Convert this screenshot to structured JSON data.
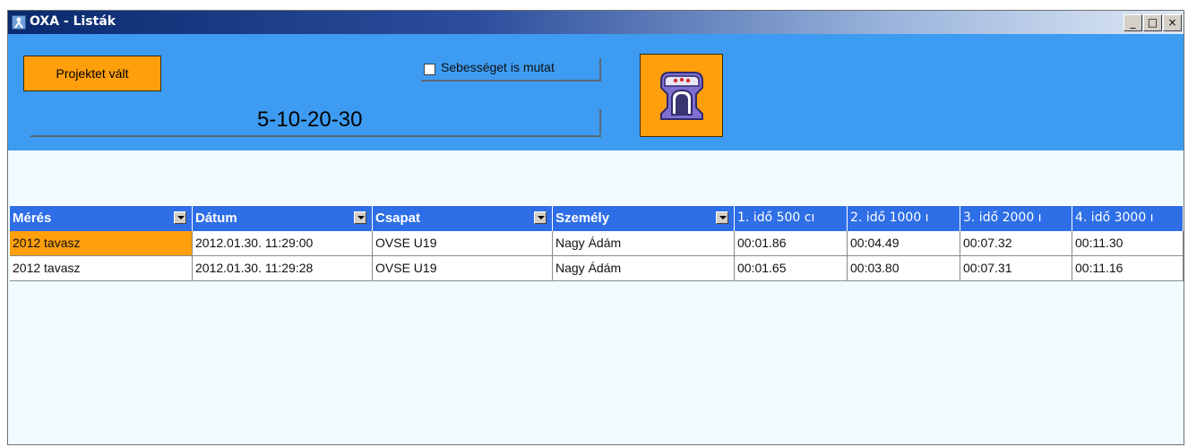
{
  "window": {
    "title": "OXA - Listák",
    "controls": {
      "minimize": "_",
      "maximize": "□",
      "close": "×"
    }
  },
  "toolbar": {
    "project_button_label": "Projektet vált",
    "speed_checkbox_label": "Sebességet is mutat",
    "speed_checkbox_checked": false,
    "range_label": "5-10-20-30",
    "exit_button_icon": "door-exit-icon"
  },
  "table": {
    "columns": [
      {
        "label": "Mérés",
        "dropdown": true
      },
      {
        "label": "Dátum",
        "dropdown": true
      },
      {
        "label": "Csapat",
        "dropdown": true
      },
      {
        "label": "Személy",
        "dropdown": true
      },
      {
        "label": "1. idő 500 cı",
        "dropdown": false
      },
      {
        "label": "2. idő 1000 ı",
        "dropdown": false
      },
      {
        "label": "3. idő 2000 ı",
        "dropdown": false
      },
      {
        "label": "4. idő 3000 ı",
        "dropdown": false
      }
    ],
    "rows": [
      [
        "2012 tavasz",
        "2012.01.30. 11:29:00",
        "OVSE U19",
        "Nagy Ádám",
        "00:01.86",
        "00:04.49",
        "00:07.32",
        "00:11.30"
      ],
      [
        "2012 tavasz",
        "2012.01.30. 11:29:28",
        "OVSE U19",
        "Nagy Ádám",
        "00:01.65",
        "00:03.80",
        "00:07.31",
        "00:11.16"
      ]
    ],
    "selected_cell": {
      "row": 0,
      "col": 0
    }
  },
  "colors": {
    "toolbar_bg": "#3d9cf2",
    "accent_orange": "#ff9f0b",
    "header_blue": "#2e6ee6",
    "body_bg": "#f1faff"
  }
}
